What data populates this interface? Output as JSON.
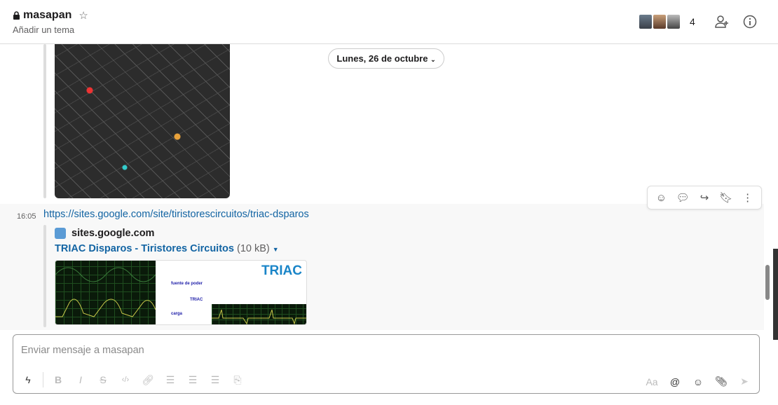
{
  "header": {
    "channel": "masapan",
    "topic": "Añadir un tema",
    "member_count": "4"
  },
  "messages": {
    "date_divider": "Lunes, 26 de octubre",
    "link_message": {
      "time": "16:05",
      "url": "https://sites.google.com/site/tiristorescircuitos/triac-dsparos",
      "site": "sites.google.com",
      "title": "TRIAC Disparos - Tiristores Circuitos",
      "size": "(10 kB)",
      "preview": {
        "heading": "TRIAC",
        "label1": "fuente de poder",
        "label2": "TRIAC",
        "label3": "carga"
      }
    }
  },
  "composer": {
    "placeholder": "Enviar mensaje a masapan",
    "format_label": "Aa"
  }
}
